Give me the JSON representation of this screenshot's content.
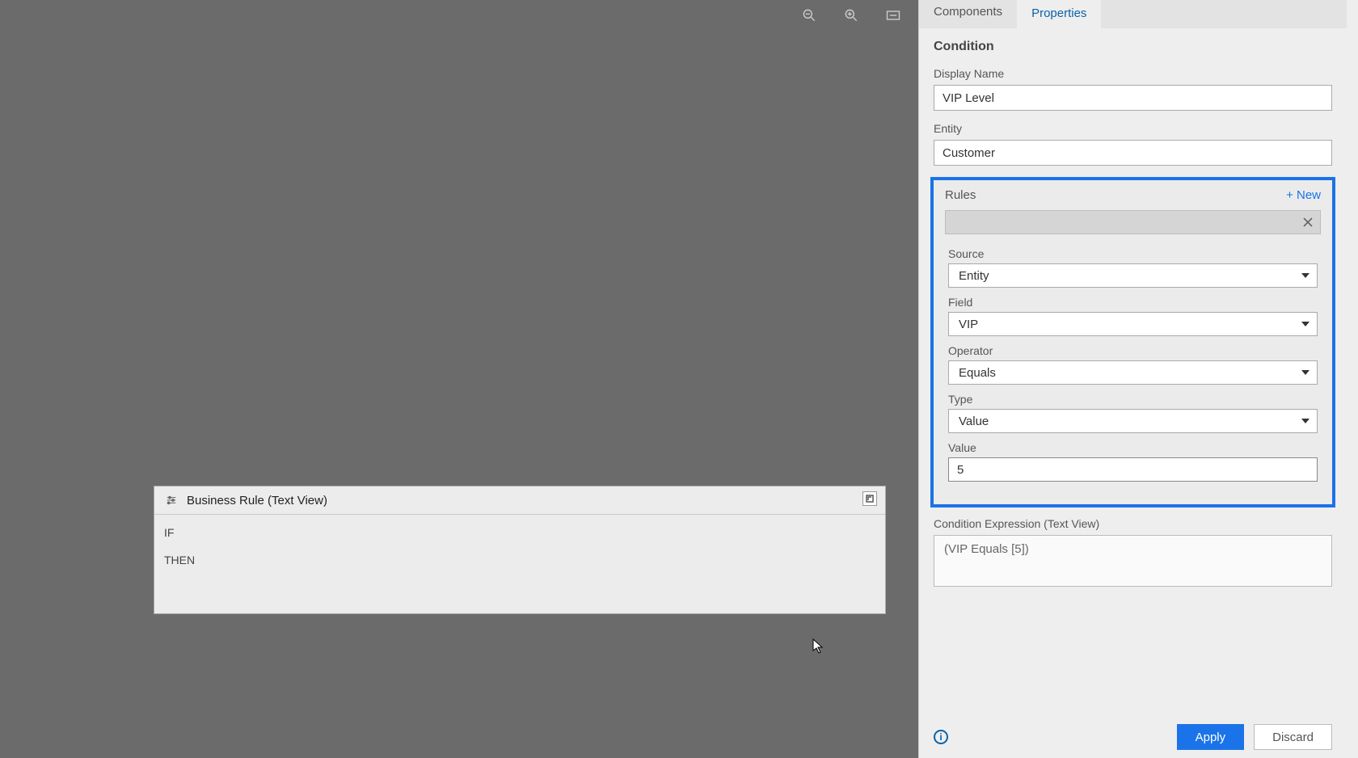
{
  "tabs": {
    "components": "Components",
    "properties": "Properties"
  },
  "condition": {
    "section_title": "Condition",
    "display_name_label": "Display Name",
    "display_name_value": "VIP Level",
    "entity_label": "Entity",
    "entity_value": "Customer"
  },
  "rules": {
    "title": "Rules",
    "new_label": "+ New",
    "source_label": "Source",
    "source_value": "Entity",
    "field_label": "Field",
    "field_value": "VIP",
    "operator_label": "Operator",
    "operator_value": "Equals",
    "type_label": "Type",
    "type_value": "Value",
    "value_label": "Value",
    "value_value": "5"
  },
  "expression": {
    "label": "Condition Expression (Text View)",
    "text": "(VIP Equals [5])"
  },
  "buttons": {
    "apply": "Apply",
    "discard": "Discard"
  },
  "text_view": {
    "title": "Business Rule (Text View)",
    "if": "IF",
    "then": "THEN"
  }
}
